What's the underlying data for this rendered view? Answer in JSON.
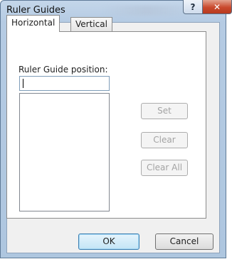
{
  "window": {
    "title": "Ruler Guides",
    "help_symbol": "?",
    "close_symbol": "✕"
  },
  "tabs": [
    {
      "label": "Horizontal",
      "selected": true
    },
    {
      "label": "Vertical",
      "selected": false
    }
  ],
  "guide": {
    "field_label": "Ruler Guide position:",
    "position_value": "",
    "list_items": []
  },
  "buttons": {
    "set": "Set",
    "clear": "Clear",
    "clear_all": "Clear All",
    "ok": "OK",
    "cancel": "Cancel"
  },
  "colors": {
    "frame": "#aec6df",
    "close_button": "#c9492d",
    "default_button_border": "#3c7fb1"
  }
}
